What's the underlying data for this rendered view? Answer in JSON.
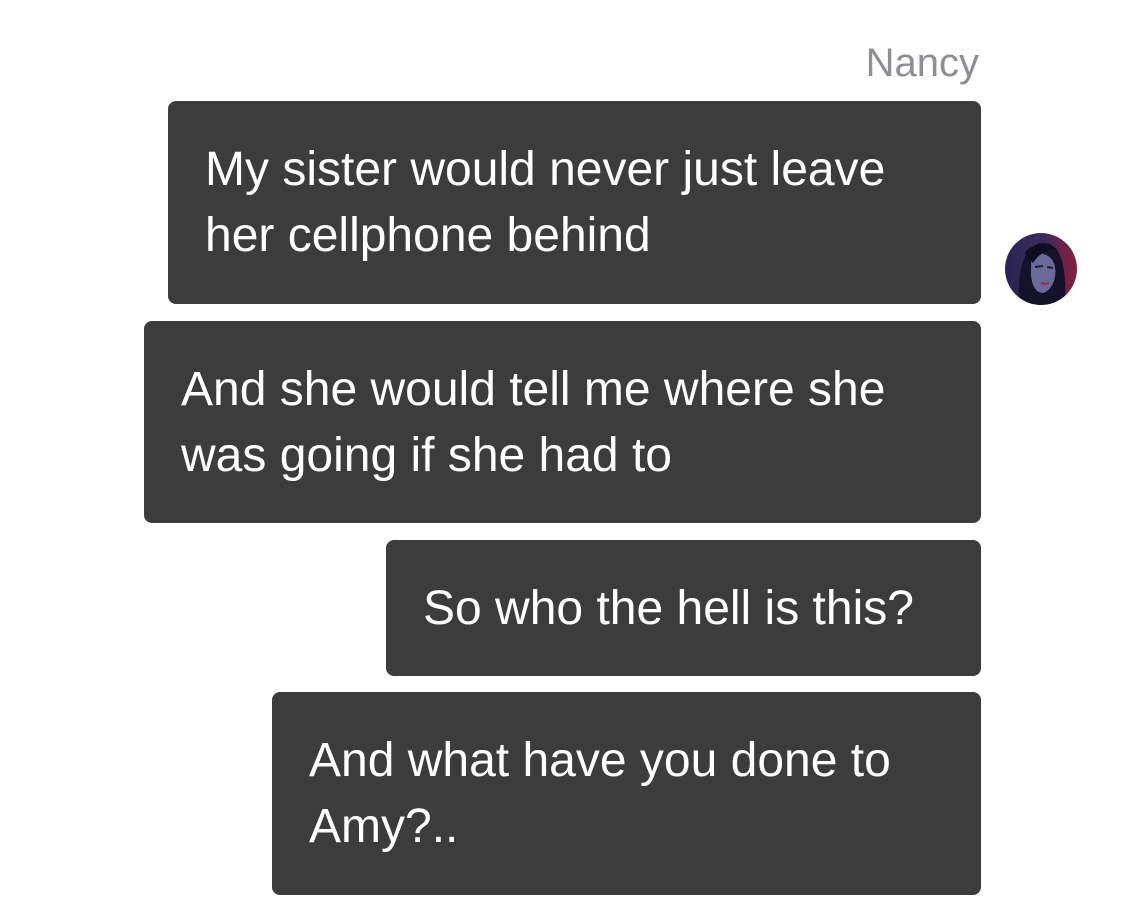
{
  "chat": {
    "sender_name": "Nancy",
    "avatar_icon": "nancy-avatar-icon",
    "colors": {
      "bubble": "#3c3c3c",
      "bubble_text": "#ffffff",
      "sender_name": "#8e8e93",
      "background": "#ffffff"
    },
    "messages": [
      {
        "lines": [
          "My sister would never just leave",
          "her cellphone behind"
        ]
      },
      {
        "lines": [
          "And she would tell me where she",
          "was going if she had to"
        ]
      },
      {
        "lines": [
          "So who the hell is this?"
        ]
      },
      {
        "lines": [
          "And what have you done to",
          "Amy?.."
        ]
      }
    ]
  }
}
